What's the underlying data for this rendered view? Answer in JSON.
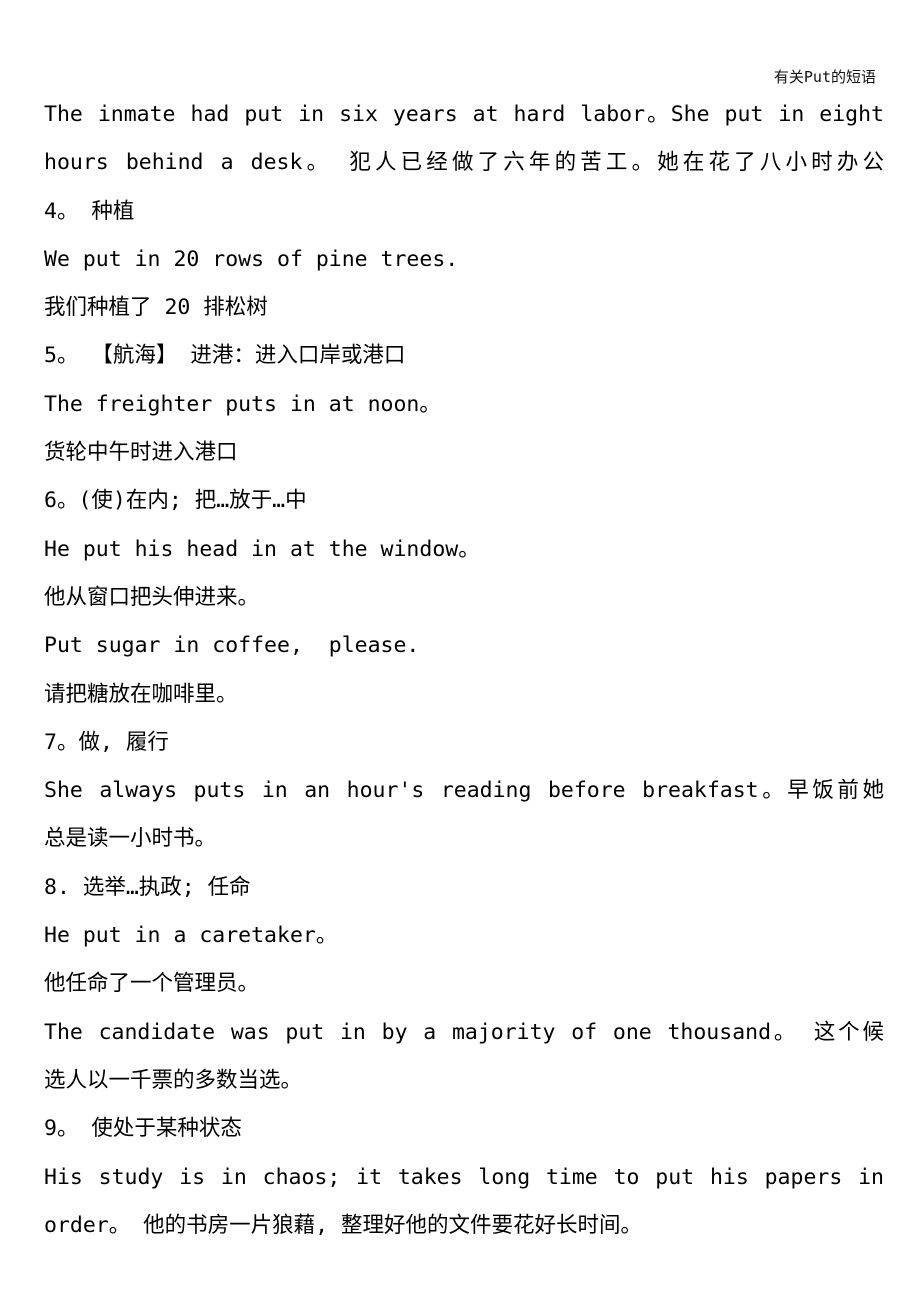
{
  "header": {
    "title": "有关Put的短语"
  },
  "lines": [
    "The inmate had put in six years at hard labor。She put in eight",
    "hours behind a desk。 犯人已经做了六年的苦工。她在花了八小时办公",
    "4。 种植",
    "We put in 20 rows of pine trees.",
    "我们种植了 20 排松树",
    "5。 【航海】 进港：进入口岸或港口",
    "The freighter puts in at noon。",
    "货轮中午时进入港口",
    "6。(使)在内; 把…放于…中",
    "He put his head in at the window。",
    "他从窗口把头伸进来。",
    "Put sugar in coffee,  please.",
    "请把糖放在咖啡里。",
    "7。做, 履行",
    "She always puts in an hour's reading before breakfast。早饭前她",
    "总是读一小时书。",
    "8. 选举…执政; 任命",
    "He put in a caretaker。",
    "他任命了一个管理员。",
    "The candidate was put in by a majority of one thousand。 这个候",
    "选人以一千票的多数当选。",
    "9。 使处于某种状态",
    "His study is in chaos;  it takes long time to put his papers in",
    "order。 他的书房一片狼藉, 整理好他的文件要花好长时间。"
  ]
}
